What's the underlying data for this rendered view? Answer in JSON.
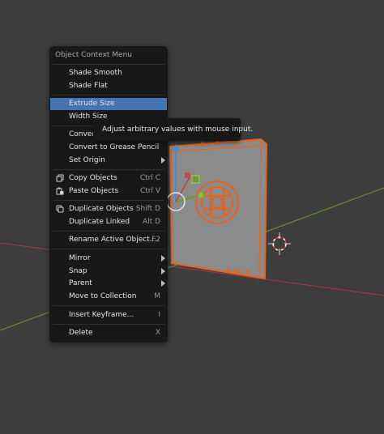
{
  "menu": {
    "title": "Object Context Menu",
    "items": [
      {
        "label": "Shade Smooth"
      },
      {
        "label": "Shade Flat"
      },
      {
        "label": "Extrude Size",
        "active": true
      },
      {
        "label": "Width Size"
      },
      {
        "label": "Convert",
        "submenu": true
      },
      {
        "label": "Convert to Grease Pencil"
      },
      {
        "label": "Set Origin",
        "submenu": true
      },
      {
        "label": "Copy Objects",
        "shortcut": "Ctrl C",
        "icon": "copy-icon"
      },
      {
        "label": "Paste Objects",
        "shortcut": "Ctrl V",
        "icon": "paste-icon"
      },
      {
        "label": "Duplicate Objects",
        "shortcut": "Shift D",
        "icon": "duplicate-icon"
      },
      {
        "label": "Duplicate Linked",
        "shortcut": "Alt D"
      },
      {
        "label": "Rename Active Object...",
        "shortcut": "F2"
      },
      {
        "label": "Mirror",
        "submenu": true
      },
      {
        "label": "Snap",
        "submenu": true
      },
      {
        "label": "Parent",
        "submenu": true
      },
      {
        "label": "Move to Collection",
        "shortcut": "M"
      },
      {
        "label": "Insert Keyframe...",
        "shortcut": "I"
      },
      {
        "label": "Delete",
        "shortcut": "X"
      }
    ]
  },
  "tooltip": {
    "text": "Adjust arbitrary values with mouse input."
  },
  "colors": {
    "viewport_bg": "#3d3d3d",
    "menu_bg": "#181818",
    "highlight": "#4772b3",
    "selection_outline": "#e8641a",
    "x_axis": "#a83a3f",
    "y_axis": "#6f9a34",
    "gizmo_z": "#4a8bd6",
    "object_fill": "#8b8b8b"
  }
}
